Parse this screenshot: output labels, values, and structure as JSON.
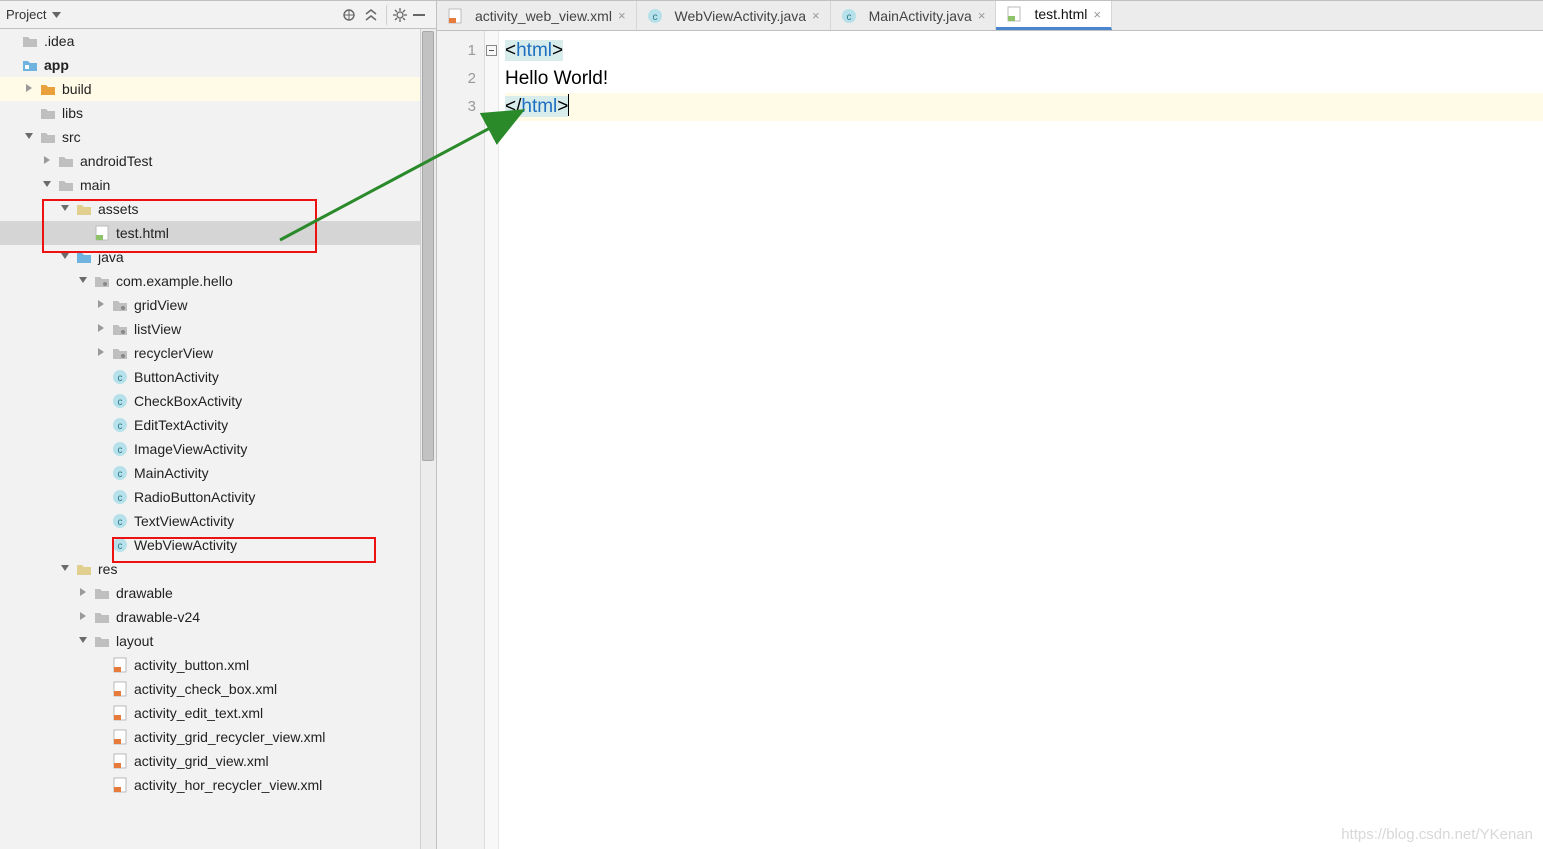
{
  "panel": {
    "title": "Project"
  },
  "tree": {
    "idea": ".idea",
    "app": "app",
    "build": "build",
    "libs": "libs",
    "src": "src",
    "androidTest": "androidTest",
    "main": "main",
    "assets": "assets",
    "test_html": "test.html",
    "java": "java",
    "pkg": "com.example.hello",
    "gridView": "gridView",
    "listView": "listView",
    "recyclerView": "recyclerView",
    "ButtonActivity": "ButtonActivity",
    "CheckBoxActivity": "CheckBoxActivity",
    "EditTextActivity": "EditTextActivity",
    "ImageViewActivity": "ImageViewActivity",
    "MainActivity": "MainActivity",
    "RadioButtonActivity": "RadioButtonActivity",
    "TextViewActivity": "TextViewActivity",
    "WebViewActivity": "WebViewActivity",
    "res": "res",
    "drawable": "drawable",
    "drawable_v24": "drawable-v24",
    "layout": "layout",
    "act_button": "activity_button.xml",
    "act_checkbox": "activity_check_box.xml",
    "act_edit": "activity_edit_text.xml",
    "act_grid_rec": "activity_grid_recycler_view.xml",
    "act_grid": "activity_grid_view.xml",
    "act_hor_rec": "activity_hor_recycler_view.xml"
  },
  "tabs": [
    {
      "label": "activity_web_view.xml",
      "kind": "xml"
    },
    {
      "label": "WebViewActivity.java",
      "kind": "java"
    },
    {
      "label": "MainActivity.java",
      "kind": "java"
    },
    {
      "label": "test.html",
      "kind": "html",
      "active": true
    }
  ],
  "code": {
    "l1a": "<",
    "l1b": "html",
    "l1c": ">",
    "l2": "Hello World!",
    "l3a": "</",
    "l3b": "html",
    "l3c": ">",
    "ln1": "1",
    "ln2": "2",
    "ln3": "3"
  },
  "watermark": "https://blog.csdn.net/YKenan"
}
